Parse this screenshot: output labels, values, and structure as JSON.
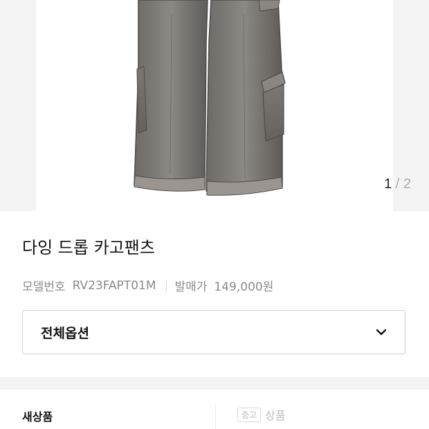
{
  "gallery": {
    "current": "1",
    "separator": "/",
    "total": "2"
  },
  "product": {
    "name": "다잉 드롭 카고팬츠",
    "model_label": "모델번호",
    "model_number": "RV23FAPT01M",
    "price_label": "발매가",
    "price": "149,000원"
  },
  "options": {
    "label": "전체옵션"
  },
  "condition_tabs": {
    "new_label": "새상품",
    "used_badge": "중고",
    "used_label": "상품"
  }
}
